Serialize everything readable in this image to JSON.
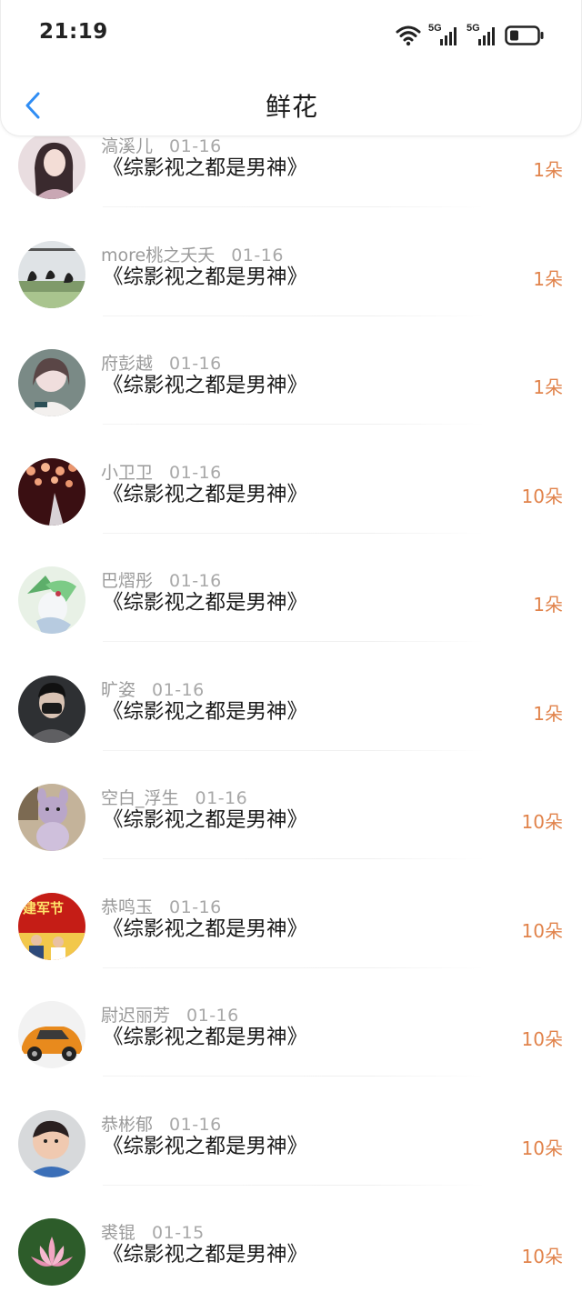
{
  "status_bar": {
    "time": "21:19",
    "network_1": "5G",
    "network_2": "5G"
  },
  "header": {
    "title": "鲜花"
  },
  "colors": {
    "count_accent": "#e1834b",
    "back_accent": "#2f8df4"
  },
  "flowers": [
    {
      "name": "滈溪儿",
      "date": "01-16",
      "book": "《综影视之都是男神》",
      "count": "1朵",
      "avatar": "portrait-girl"
    },
    {
      "name": "more桃之夭夭",
      "date": "01-16",
      "book": "《综影视之都是男神》",
      "count": "1朵",
      "avatar": "swans-lake"
    },
    {
      "name": "府彭越",
      "date": "01-16",
      "book": "《综影视之都是男神》",
      "count": "1朵",
      "avatar": "girl-white"
    },
    {
      "name": "小卫卫",
      "date": "01-16",
      "book": "《综影视之都是男神》",
      "count": "10朵",
      "avatar": "lanterns-night"
    },
    {
      "name": "巴熠彤",
      "date": "01-16",
      "book": "《综影视之都是男神》",
      "count": "1朵",
      "avatar": "green-creature"
    },
    {
      "name": "旷姿",
      "date": "01-16",
      "book": "《综影视之都是男神》",
      "count": "1朵",
      "avatar": "man-mask"
    },
    {
      "name": "空白_浮生",
      "date": "01-16",
      "book": "《综影视之都是男神》",
      "count": "10朵",
      "avatar": "plush-toy"
    },
    {
      "name": "恭鸣玉",
      "date": "01-16",
      "book": "《综影视之都是男神》",
      "count": "10朵",
      "avatar": "army-day"
    },
    {
      "name": "尉迟丽芳",
      "date": "01-16",
      "book": "《综影视之都是男神》",
      "count": "10朵",
      "avatar": "orange-car"
    },
    {
      "name": "恭彬郁",
      "date": "01-16",
      "book": "《综影视之都是男神》",
      "count": "10朵",
      "avatar": "child-face"
    },
    {
      "name": "裘锟",
      "date": "01-15",
      "book": "《综影视之都是男神》",
      "count": "10朵",
      "avatar": "lotus-flower"
    }
  ]
}
